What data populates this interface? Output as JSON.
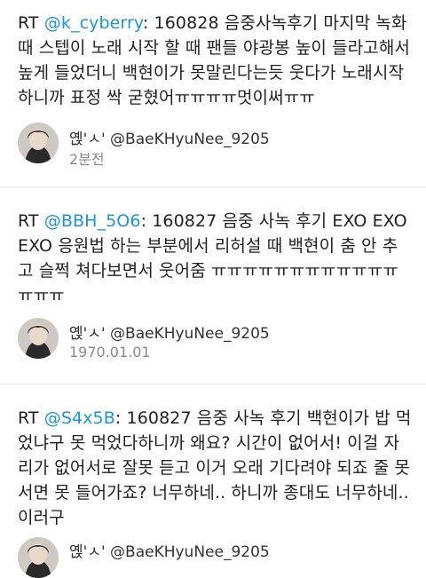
{
  "tweets": [
    {
      "prefix": "RT ",
      "mention": "@k_cyberry",
      "body": ": 160828 음중사녹후기 마지막 녹화때 스텝이 노래 시작 할 때 팬들 야광봉 높이 들라고해서 높게 들었더니 백현이가 못말린다는듯 웃다가 노래시작 하니까 표정 싹 굳혔어ㅠㅠㅠㅠ멋이써ㅠㅠ",
      "author": "옍'ㅅ' @BaeKHyuNee_9205",
      "time": "2분전"
    },
    {
      "prefix": "RT ",
      "mention": "@BBH_5O6",
      "body": ": 160827 음중 사녹 후기 EXO EXO EXO 응원법 하는 부분에서 리허설 때 백현이 춤 안 추고 슬쩍 쳐다보면서 웃어줌 ㅠㅠㅠㅠㅠㅠㅠㅠㅠㅠㅠㅠㅠㅠㅠ",
      "author": "옍'ㅅ' @BaeKHyuNee_9205",
      "time": "1970.01.01"
    },
    {
      "prefix": "RT ",
      "mention": "@S4x5B",
      "body": ": 160827 음중 사녹 후기 백현이가 밥 먹었냐구 못 먹었다하니까 왜요? 시간이 없어서! 이걸 자리가 없어서로 잘못 듣고 이거 오래 기다려야 되죠 줄 못 서면 못 들어가죠? 너무하네.. 하니까 종대도 너무하네.. 이러구",
      "author": "옍'ㅅ' @BaeKHyuNee_9205",
      "time": ""
    }
  ]
}
